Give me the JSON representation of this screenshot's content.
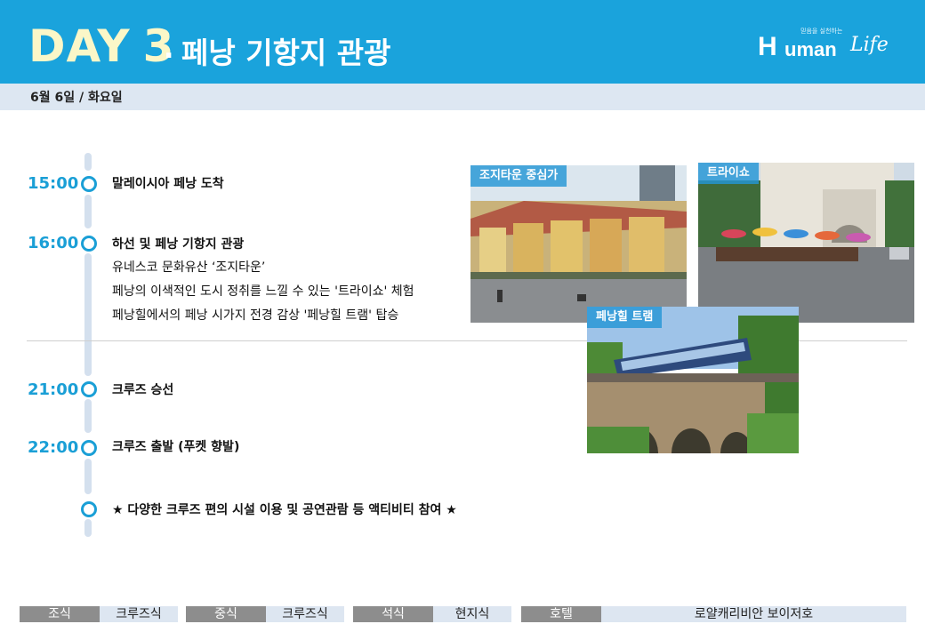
{
  "header": {
    "day_word": "DAY",
    "day_number": "3",
    "dot": ".",
    "title": "페낭 기항지 관광",
    "logo": {
      "tagline": "믿음을 실천하는",
      "mark": "H",
      "word": "uman",
      "script": "Life"
    }
  },
  "date": "6월 6일 / 화요일",
  "schedule": {
    "items": [
      {
        "time": "15:00",
        "title": "말레이시아 페낭 도착"
      },
      {
        "time": "16:00",
        "title": "하선 및 페낭 기항지 관광",
        "details": [
          "유네스코 문화유산 ‘조지타운’",
          "페낭의 이색적인 도시 정취를 느낄 수 있는 '트라이쇼' 체험",
          "페낭힐에서의 페낭 시가지 전경 감상 '페낭힐 트램' 탑승"
        ]
      },
      {
        "time": "21:00",
        "title": "크루즈 승선"
      },
      {
        "time": "22:00",
        "title": "크루즈 출발 (푸켓 향발)"
      },
      {
        "time": "",
        "title": "★ 다양한 크루즈 편의 시설 이용 및 공연관람 등 액티비티 참여 ★"
      }
    ]
  },
  "photos": {
    "georgetown": "조지타운 중심가",
    "trishaw": "트라이쇼",
    "tram": "페낭힐 트램"
  },
  "footer": {
    "breakfast_label": "조식",
    "breakfast_value": "크루즈식",
    "lunch_label": "중식",
    "lunch_value": "크루즈식",
    "dinner_label": "석식",
    "dinner_value": "현지식",
    "hotel_label": "호텔",
    "hotel_value": "로얄캐리비안 보이저호"
  },
  "colors": {
    "brand_blue": "#1aa3dc",
    "accent_yellow": "#fbf7c8",
    "timeline": "#d4e0ee",
    "footer_gray": "#8d8d8d"
  }
}
